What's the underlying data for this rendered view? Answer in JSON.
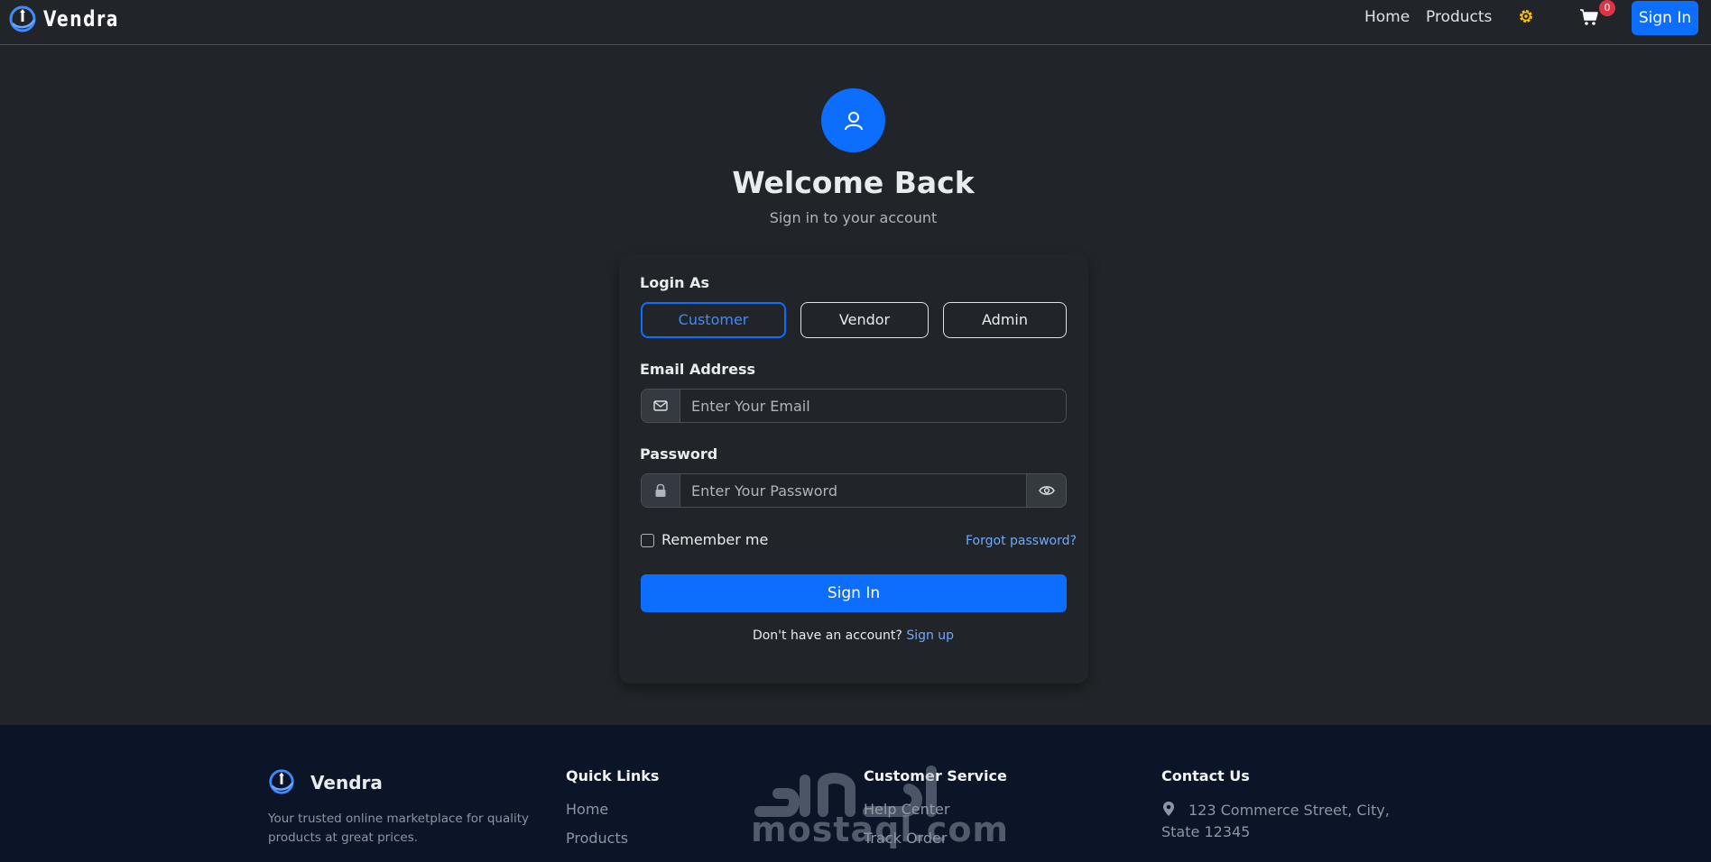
{
  "navbar": {
    "brand": "Vendra",
    "links": {
      "home": "Home",
      "products": "Products"
    },
    "cart_count": "0",
    "signin_label": "Sign In",
    "icons": {
      "logo": "vendra-logo",
      "settings": "gear-icon",
      "cart": "cart-icon"
    },
    "accent_color": "#0d6efd",
    "gear_color": "#ffc107"
  },
  "login": {
    "title": "Welcome Back",
    "subtitle": "Sign in to your account",
    "login_as_label": "Login As",
    "roles": [
      "Customer",
      "Vendor",
      "Admin"
    ],
    "selected_role": "Customer",
    "email": {
      "label": "Email Address",
      "placeholder": "Enter Your Email",
      "value": ""
    },
    "password": {
      "label": "Password",
      "placeholder": "Enter Your Password",
      "value": ""
    },
    "remember_me": "Remember me",
    "forgot_password": "Forgot password?",
    "submit_label": "Sign In",
    "no_account_text": "Don't have an account?",
    "signup_link": "Sign up"
  },
  "footer": {
    "brand": "Vendra",
    "description": "Your trusted online marketplace for quality products at great prices.",
    "quick_links": {
      "heading": "Quick Links",
      "items": [
        "Home",
        "Products"
      ]
    },
    "customer_service": {
      "heading": "Customer Service",
      "items": [
        "Help Center",
        "Track Order"
      ]
    },
    "contact": {
      "heading": "Contact Us",
      "address": "123 Commerce Street, City, State 12345"
    },
    "background_color": "#0c1527"
  },
  "watermark": {
    "latin": "mostaql.com"
  }
}
